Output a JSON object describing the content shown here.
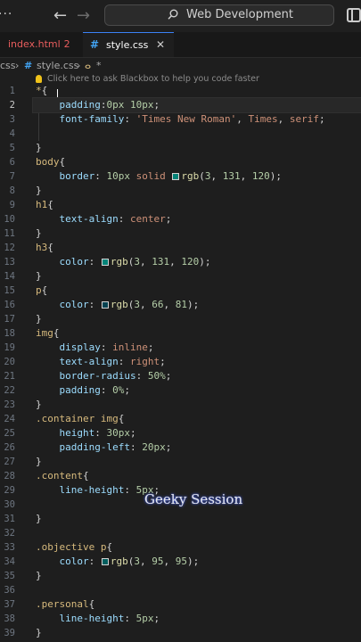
{
  "titlebar": {
    "edge_glyphs": "···",
    "back_icon": "arrow-left-icon",
    "forward_icon": "arrow-right-icon",
    "search_text": "Web Development",
    "layout_icon": "layout-sidebar-icon"
  },
  "tabs": [
    {
      "label": "index.html",
      "problems": "2",
      "color": "#e85d5d"
    },
    {
      "label": "style.css",
      "close": "✕",
      "active": true
    }
  ],
  "breadcrumb": {
    "prefix": "css",
    "sep": "›",
    "file": "style.css",
    "symbol": "*"
  },
  "hint": "Click here to ask Blackbox to help you code faster",
  "editor": {
    "active_line": 2,
    "lines": [
      {
        "n": "1",
        "text": "*{"
      },
      {
        "n": "2",
        "text": "    padding:0px 10px;"
      },
      {
        "n": "3",
        "text": "    font-family: 'Times New Roman', Times, serif;"
      },
      {
        "n": "4",
        "text": ""
      },
      {
        "n": "5",
        "text": "}"
      },
      {
        "n": "6",
        "text": "body{"
      },
      {
        "n": "7",
        "text": "    border: 10px solid rgb(3, 131, 120);"
      },
      {
        "n": "8",
        "text": "}"
      },
      {
        "n": "9",
        "text": "h1{"
      },
      {
        "n": "10",
        "text": "    text-align: center;"
      },
      {
        "n": "11",
        "text": "}"
      },
      {
        "n": "12",
        "text": "h3{"
      },
      {
        "n": "13",
        "text": "    color: rgb(3, 131, 120);"
      },
      {
        "n": "14",
        "text": "}"
      },
      {
        "n": "15",
        "text": "p{"
      },
      {
        "n": "16",
        "text": "    color: rgb(3, 66, 81);"
      },
      {
        "n": "17",
        "text": "}"
      },
      {
        "n": "18",
        "text": "img{"
      },
      {
        "n": "19",
        "text": "    display: inline;"
      },
      {
        "n": "20",
        "text": "    text-align: right;"
      },
      {
        "n": "21",
        "text": "    border-radius: 50%;"
      },
      {
        "n": "22",
        "text": "    padding: 0%;"
      },
      {
        "n": "23",
        "text": "}"
      },
      {
        "n": "24",
        "text": ".container img{"
      },
      {
        "n": "25",
        "text": "    height: 30px;"
      },
      {
        "n": "26",
        "text": "    padding-left: 20px;"
      },
      {
        "n": "27",
        "text": "}"
      },
      {
        "n": "28",
        "text": ".content{"
      },
      {
        "n": "29",
        "text": "    line-height: 5px;"
      },
      {
        "n": "30",
        "text": ""
      },
      {
        "n": "31",
        "text": "}"
      },
      {
        "n": "32",
        "text": ""
      },
      {
        "n": "33",
        "text": ".objective p{"
      },
      {
        "n": "34",
        "text": "    color: rgb(3, 95, 95);"
      },
      {
        "n": "35",
        "text": "}"
      },
      {
        "n": "36",
        "text": ""
      },
      {
        "n": "37",
        "text": ".personal{"
      },
      {
        "n": "38",
        "text": "    line-height: 5px;"
      },
      {
        "n": "39",
        "text": "}"
      }
    ]
  },
  "watermark": "Geeky Session",
  "colors": {
    "editor_bg": "#1e1e1e",
    "accent": "#3b82f6",
    "selector": "#d7ba7d",
    "property": "#9cdcfe",
    "number": "#b5cea8",
    "string": "#ce9178",
    "function": "#dcdcaa",
    "swatch_teal": "#038378",
    "swatch_dark": "#034251",
    "swatch_mid": "#035f5f"
  }
}
